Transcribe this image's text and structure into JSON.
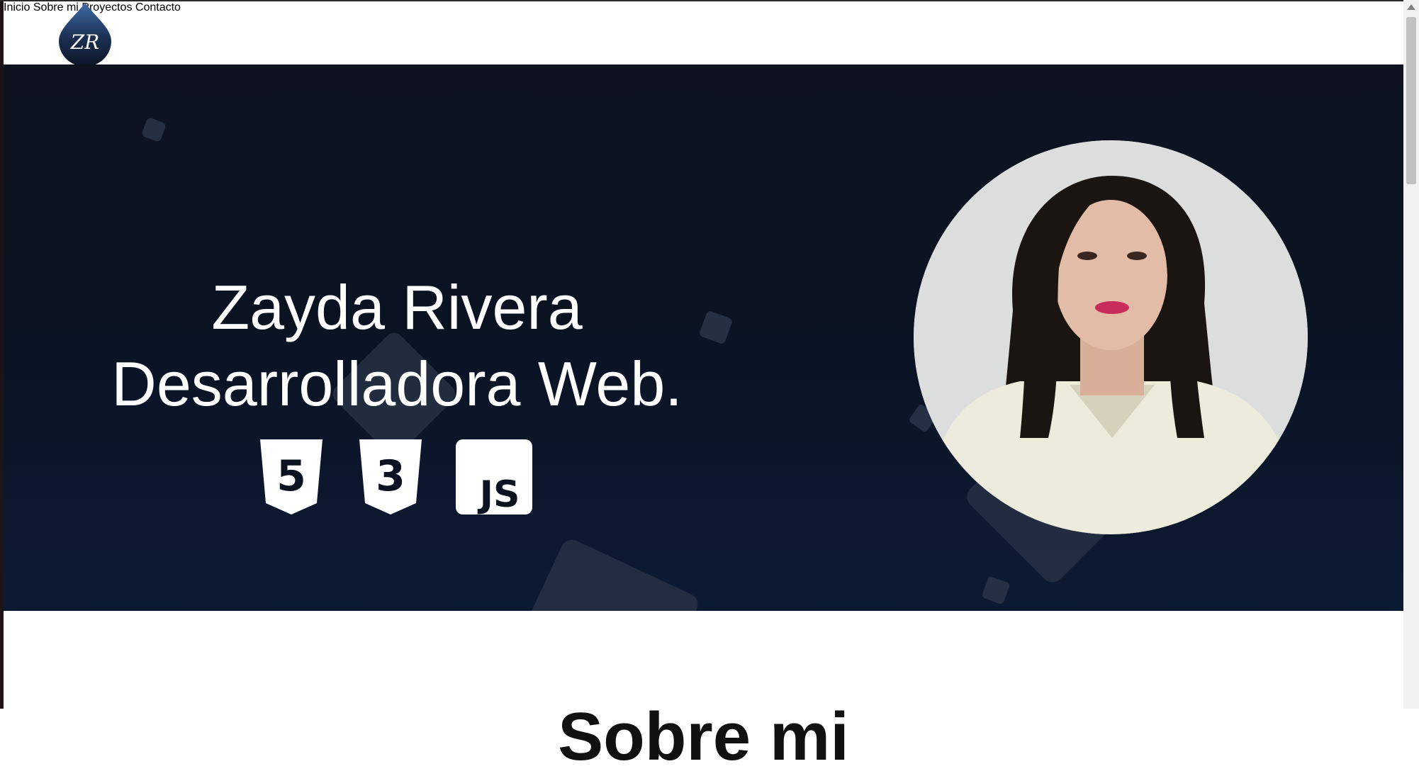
{
  "header": {
    "logo_text": "ZR",
    "nav": [
      {
        "label": "Inicio"
      },
      {
        "label": "Sobre mi"
      },
      {
        "label": "Proyectos"
      },
      {
        "label": "Contacto"
      }
    ]
  },
  "hero": {
    "name": "Zayda Rivera",
    "role": "Desarrolladora Web.",
    "tech_icons": [
      {
        "name": "html5-icon",
        "label": "5"
      },
      {
        "name": "css3-icon",
        "label": "3"
      },
      {
        "name": "javascript-icon",
        "label": "JS"
      }
    ]
  },
  "about": {
    "title": "Sobre mi"
  },
  "colors": {
    "hero_bg": "#0b1322",
    "logo": "#2b4a79",
    "text_dark": "#202020"
  }
}
